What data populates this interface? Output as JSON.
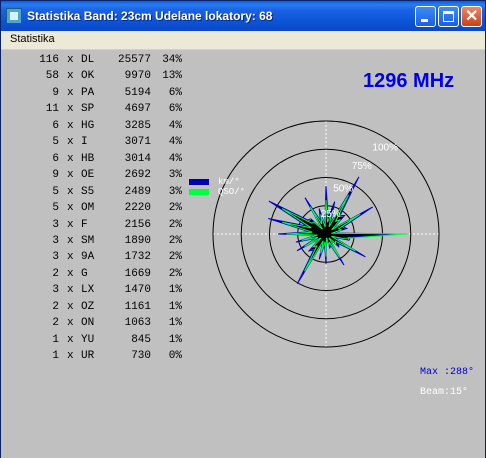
{
  "window": {
    "title": "Statistika  Band: 23cm  Udelane lokatory: 68"
  },
  "menu": {
    "items": [
      "Statistika"
    ]
  },
  "frequency": "1296 MHz",
  "stats": [
    {
      "count": "116",
      "x": "x",
      "call": "DL",
      "number": "25577",
      "percent": "34%"
    },
    {
      "count": "58",
      "x": "x",
      "call": "OK",
      "number": "9970",
      "percent": "13%"
    },
    {
      "count": "9",
      "x": "x",
      "call": "PA",
      "number": "5194",
      "percent": "6%"
    },
    {
      "count": "11",
      "x": "x",
      "call": "SP",
      "number": "4697",
      "percent": "6%"
    },
    {
      "count": "6",
      "x": "x",
      "call": "HG",
      "number": "3285",
      "percent": "4%"
    },
    {
      "count": "5",
      "x": "x",
      "call": "I",
      "number": "3071",
      "percent": "4%"
    },
    {
      "count": "6",
      "x": "x",
      "call": "HB",
      "number": "3014",
      "percent": "4%"
    },
    {
      "count": "9",
      "x": "x",
      "call": "OE",
      "number": "2692",
      "percent": "3%"
    },
    {
      "count": "5",
      "x": "x",
      "call": "S5",
      "number": "2489",
      "percent": "3%"
    },
    {
      "count": "5",
      "x": "x",
      "call": "OM",
      "number": "2220",
      "percent": "2%"
    },
    {
      "count": "3",
      "x": "x",
      "call": "F",
      "number": "2156",
      "percent": "2%"
    },
    {
      "count": "3",
      "x": "x",
      "call": "SM",
      "number": "1890",
      "percent": "2%"
    },
    {
      "count": "3",
      "x": "x",
      "call": "9A",
      "number": "1732",
      "percent": "2%"
    },
    {
      "count": "2",
      "x": "x",
      "call": "G",
      "number": "1669",
      "percent": "2%"
    },
    {
      "count": "3",
      "x": "x",
      "call": "LX",
      "number": "1470",
      "percent": "1%"
    },
    {
      "count": "2",
      "x": "x",
      "call": "OZ",
      "number": "1161",
      "percent": "1%"
    },
    {
      "count": "2",
      "x": "x",
      "call": "ON",
      "number": "1063",
      "percent": "1%"
    },
    {
      "count": "1",
      "x": "x",
      "call": "YU",
      "number": "845",
      "percent": "1%"
    },
    {
      "count": "1",
      "x": "x",
      "call": "UR",
      "number": "730",
      "percent": "0%"
    }
  ],
  "legend": [
    {
      "label": "km/°",
      "color": "#0000b0"
    },
    {
      "label": "QSO/°",
      "color": "#00ff40"
    }
  ],
  "polar": {
    "ring_labels": [
      "25%",
      "50%",
      "75%",
      "100%"
    ],
    "max_text": "Max :288°",
    "beam_text": "Beam:15°",
    "colors": {
      "fill": "#000000",
      "km_line": "#0000d0",
      "qso_line": "#00ff40",
      "ring": "#000000",
      "axis": "#ffffff"
    }
  },
  "chart_data": {
    "type": "polar",
    "angles_deg": [
      0,
      15,
      30,
      45,
      60,
      75,
      90,
      105,
      120,
      135,
      150,
      165,
      180,
      195,
      210,
      225,
      240,
      255,
      270,
      285,
      300,
      315,
      330,
      345
    ],
    "series": [
      {
        "name": "km/°",
        "values": [
          40,
          28,
          55,
          22,
          45,
          18,
          58,
          20,
          38,
          15,
          30,
          12,
          25,
          22,
          48,
          20,
          28,
          26,
          40,
          50,
          55,
          18,
          35,
          22
        ]
      },
      {
        "name": "QSO/°",
        "values": [
          30,
          20,
          40,
          18,
          35,
          14,
          72,
          15,
          30,
          12,
          24,
          10,
          20,
          18,
          38,
          16,
          22,
          22,
          35,
          40,
          45,
          15,
          28,
          18
        ]
      }
    ],
    "rlim": [
      0,
      100
    ],
    "max_direction_deg": 288,
    "beam_deg": 15
  }
}
